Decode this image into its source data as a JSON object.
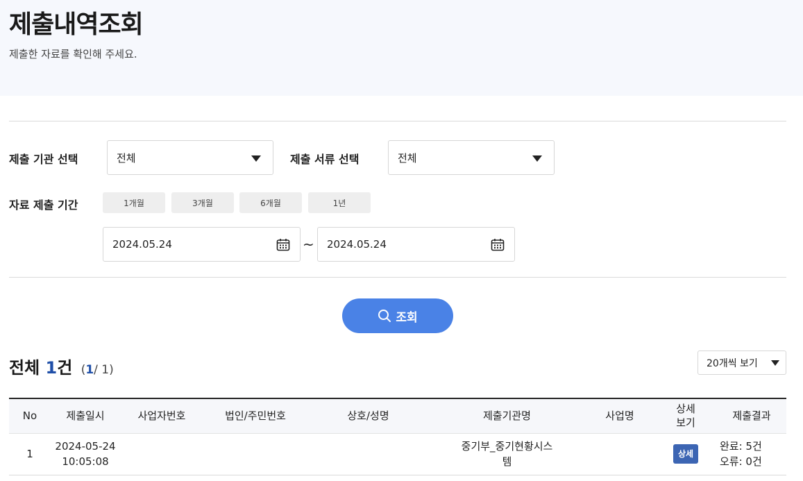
{
  "header": {
    "title": "제출내역조회",
    "subtitle": "제출한 자료를 확인해 주세요."
  },
  "filters": {
    "agency_label": "제출 기관 선택",
    "agency_value": "전체",
    "document_label": "제출 서류 선택",
    "document_value": "전체",
    "period_label": "자료 제출 기간",
    "period_buttons": [
      "1개월",
      "3개월",
      "6개월",
      "1년"
    ],
    "date_from": "2024.05.24",
    "date_separator": "~",
    "date_to": "2024.05.24",
    "search_label": "조회"
  },
  "summary": {
    "total_label": "전체",
    "total_count": "1",
    "total_unit": "건",
    "page_open": "(",
    "current_page": "1",
    "page_rest": "/ 1)",
    "per_page": "20개씩 보기"
  },
  "table": {
    "headers": {
      "no": "No",
      "submitted_at": "제출일시",
      "business_no": "사업자번호",
      "corp_no": "법인/주민번호",
      "company_name": "상호/성명",
      "agency_name": "제출기관명",
      "project_name": "사업명",
      "detail_line1": "상세",
      "detail_line2": "보기",
      "result": "제출결과"
    },
    "rows": [
      {
        "no": "1",
        "date": "2024-05-24",
        "time": "10:05:08",
        "business_no": "",
        "corp_no": "",
        "company_name": "",
        "agency_line1": "중기부_중기현황시스",
        "agency_line2": "템",
        "project_name": "",
        "detail": "상세",
        "result_ok": "완료: 5건",
        "result_err": "오류: 0건"
      }
    ]
  }
}
